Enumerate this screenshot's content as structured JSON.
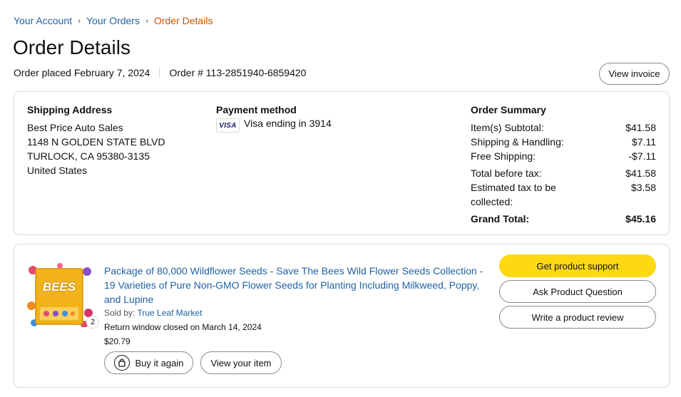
{
  "breadcrumb": {
    "items": [
      "Your Account",
      "Your Orders"
    ],
    "current": "Order Details",
    "separator": "›"
  },
  "page": {
    "title": "Order Details"
  },
  "order": {
    "placed": "Order placed February 7, 2024",
    "number": "Order # 113-2851940-6859420",
    "invoice_label": "View invoice"
  },
  "shipping": {
    "heading": "Shipping Address",
    "lines": [
      "Best Price Auto Sales",
      "1148 N GOLDEN STATE BLVD",
      "TURLOCK, CA 95380-3135",
      "United States"
    ]
  },
  "payment": {
    "heading": "Payment method",
    "card_brand": "VISA",
    "text": "Visa ending in 3914"
  },
  "summary": {
    "heading": "Order Summary",
    "rows": [
      {
        "label": "Item(s) Subtotal:",
        "value": "$41.58"
      },
      {
        "label": "Shipping & Handling:",
        "value": "$7.11"
      },
      {
        "label": "Free Shipping:",
        "value": "-$7.11"
      },
      {
        "label": "Total before tax:",
        "value": "$41.58"
      },
      {
        "label": "Estimated tax to be collected:",
        "value": "$3.58"
      }
    ],
    "grand": {
      "label": "Grand Total:",
      "value": "$45.16"
    }
  },
  "item": {
    "title": "Package of 80,000 Wildflower Seeds - Save The Bees Wild Flower Seeds Collection - 19 Varieties of Pure Non-GMO Flower Seeds for Planting Including Milkweed, Poppy, and Lupine",
    "sold_by_prefix": "Sold by: ",
    "seller": "True Leaf Market",
    "return_window": "Return window closed on March 14, 2024",
    "price": "$20.79",
    "quantity": "2",
    "image_label": "BEES",
    "buy_again_label": "Buy it again",
    "view_item_label": "View your item"
  },
  "actions": {
    "support": "Get product support",
    "question": "Ask Product Question",
    "review": "Write a product review"
  },
  "colors": {
    "link": "#2162a1",
    "breadcrumb_current": "#c45500",
    "primary_button": "#ffd814",
    "border": "#d5d9d9"
  }
}
